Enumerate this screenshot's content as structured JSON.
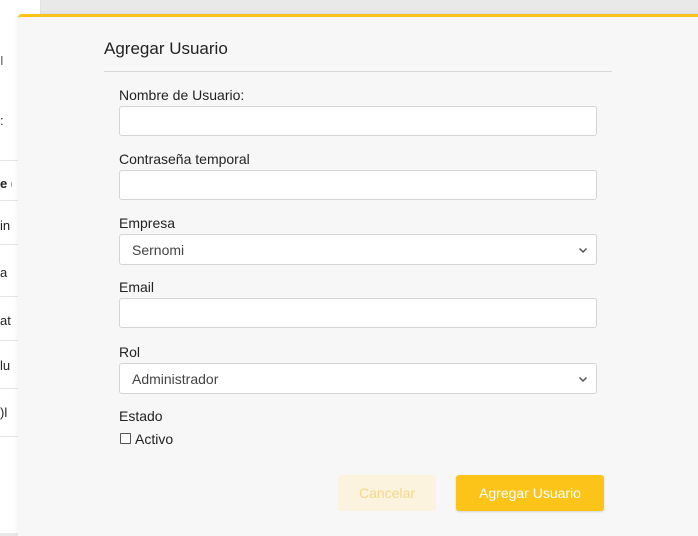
{
  "background": {
    "fragments": [
      "I",
      ":",
      "e (",
      "in",
      "a",
      "at",
      "lu",
      ")l"
    ]
  },
  "modal": {
    "title": "Agregar Usuario",
    "fields": {
      "username": {
        "label": "Nombre de Usuario:",
        "value": ""
      },
      "temp_password": {
        "label": "Contraseña temporal",
        "value": ""
      },
      "company": {
        "label": "Empresa",
        "value": "Sernomi"
      },
      "email": {
        "label": "Email",
        "value": ""
      },
      "role": {
        "label": "Rol",
        "value": "Administrador"
      },
      "status": {
        "label": "Estado",
        "checkbox_label": "Activo",
        "checked": false
      }
    },
    "buttons": {
      "cancel": "Cancelar",
      "submit": "Agregar Usuario"
    }
  },
  "colors": {
    "accent": "#fcc419",
    "cancel_bg": "#fbf3dd",
    "cancel_text": "#f4d78a"
  }
}
